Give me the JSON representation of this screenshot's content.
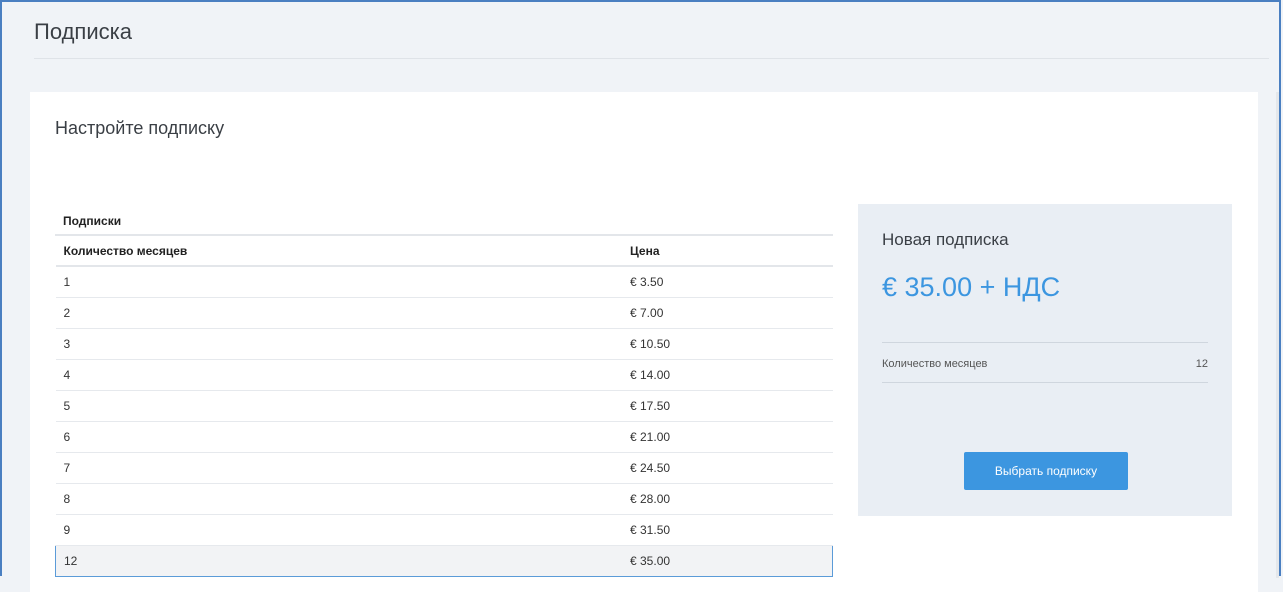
{
  "page": {
    "title": "Подписка"
  },
  "card": {
    "title": "Настройте подписку"
  },
  "table": {
    "caption": "Подписки",
    "headers": [
      "Количество месяцев",
      "Цена"
    ],
    "rows": [
      {
        "months": "1",
        "price": "€ 3.50"
      },
      {
        "months": "2",
        "price": "€ 7.00"
      },
      {
        "months": "3",
        "price": "€ 10.50"
      },
      {
        "months": "4",
        "price": "€ 14.00"
      },
      {
        "months": "5",
        "price": "€ 17.50"
      },
      {
        "months": "6",
        "price": "€ 21.00"
      },
      {
        "months": "7",
        "price": "€ 24.50"
      },
      {
        "months": "8",
        "price": "€ 28.00"
      },
      {
        "months": "9",
        "price": "€ 31.50"
      },
      {
        "months": "12",
        "price": "€ 35.00"
      }
    ],
    "selected_months": "12"
  },
  "summary": {
    "title": "Новая подписка",
    "price": "€ 35.00 + НДС",
    "months_label": "Количество месяцев",
    "months_value": "12",
    "button_label": "Выбрать подписку"
  },
  "colors": {
    "accent": "#3c96e0",
    "selected_border": "#5b9bd8",
    "summary_bg": "#e9eef4",
    "page_bg": "#f0f3f7"
  }
}
